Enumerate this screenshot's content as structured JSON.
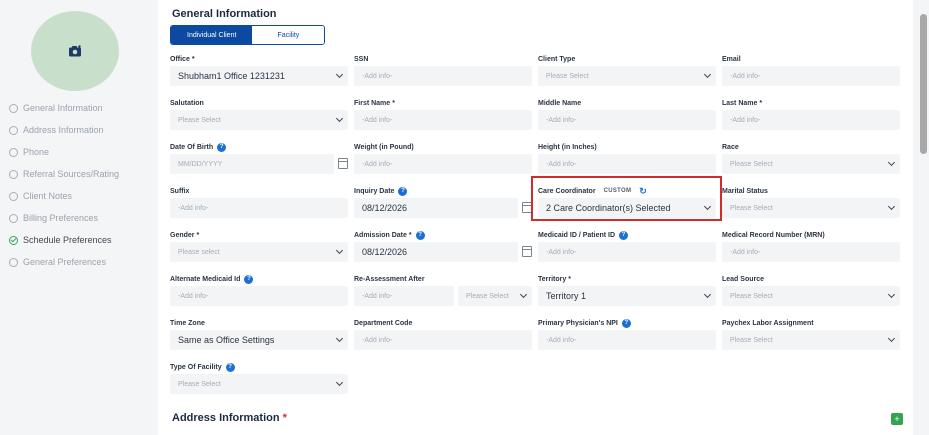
{
  "sidebar": {
    "items": [
      {
        "label": "General Information",
        "done": false
      },
      {
        "label": "Address Information",
        "done": false
      },
      {
        "label": "Phone",
        "done": false
      },
      {
        "label": "Referral Sources/Rating",
        "done": false
      },
      {
        "label": "Client Notes",
        "done": false
      },
      {
        "label": "Billing Preferences",
        "done": false
      },
      {
        "label": "Schedule Preferences",
        "done": true
      },
      {
        "label": "General Preferences",
        "done": false
      }
    ]
  },
  "general": {
    "title": "General Information",
    "toggle": {
      "individual": "Individual Client",
      "facility": "Facility"
    }
  },
  "fields": {
    "office": {
      "label": "Office",
      "req": "*",
      "value": "Shubham1 Office 1231231"
    },
    "ssn": {
      "label": "SSN",
      "placeholder": "-Add info-"
    },
    "client_type": {
      "label": "Client Type",
      "placeholder": "Please Select"
    },
    "email": {
      "label": "Email",
      "placeholder": "-Add info-"
    },
    "salutation": {
      "label": "Salutation",
      "placeholder": "Please Select"
    },
    "first_name": {
      "label": "First Name",
      "req": "*",
      "placeholder": "-Add info-"
    },
    "middle_name": {
      "label": "Middle Name",
      "placeholder": "-Add info-"
    },
    "last_name": {
      "label": "Last Name",
      "req": "*",
      "placeholder": "-Add info-"
    },
    "dob": {
      "label": "Date Of Birth",
      "placeholder": "MM/DD/YYYY"
    },
    "weight": {
      "label": "Weight (in Pound)",
      "placeholder": "-Add info-"
    },
    "height": {
      "label": "Height (in Inches)",
      "placeholder": "-Add info-"
    },
    "race": {
      "label": "Race",
      "placeholder": "Please Select"
    },
    "suffix": {
      "label": "Suffix",
      "placeholder": "-Add info-"
    },
    "inquiry_date": {
      "label": "Inquiry Date",
      "value": "08/12/2026"
    },
    "care_coordinator": {
      "label": "Care Coordinator",
      "tag": "CUSTOM",
      "value": "2 Care Coordinator(s) Selected"
    },
    "marital_status": {
      "label": "Marital Status",
      "placeholder": "Please Select"
    },
    "gender": {
      "label": "Gender",
      "req": "*",
      "placeholder": "Please select"
    },
    "admission_date": {
      "label": "Admission Date",
      "req": "*",
      "value": "08/12/2026"
    },
    "medicaid_id": {
      "label": "Medicaid ID / Patient ID",
      "placeholder": "-Add info-"
    },
    "mrn": {
      "label": "Medical Record Number (MRN)",
      "placeholder": "-Add info-"
    },
    "alt_medicaid": {
      "label": "Alternate Medicaid Id",
      "placeholder": "-Add info-"
    },
    "reassessment": {
      "label": "Re-Assessment After",
      "placeholder": "-Add info-",
      "unit_placeholder": "Please Select"
    },
    "territory": {
      "label": "Territory",
      "req": "*",
      "value": "Territory 1"
    },
    "lead_source": {
      "label": "Lead Source",
      "placeholder": "Please Select"
    },
    "time_zone": {
      "label": "Time Zone",
      "value": "Same as Office Settings"
    },
    "department_code": {
      "label": "Department Code",
      "placeholder": "-Add info-"
    },
    "primary_npi": {
      "label": "Primary Physician's NPI",
      "placeholder": "-Add info-"
    },
    "paychex": {
      "label": "Paychex Labor Assignment",
      "placeholder": "Please Select"
    },
    "facility_type": {
      "label": "Type Of Facility",
      "placeholder": "Please Select"
    }
  },
  "address": {
    "title": "Address Information",
    "req": "*",
    "add_label": "+"
  },
  "colors": {
    "accent": "#0b4aa0",
    "info": "#1c6fd6",
    "highlight": "#d12c2c",
    "success": "#35a452"
  },
  "icons": {
    "avatar": "camera-icon",
    "info": "help-circle-icon",
    "calendar": "calendar-icon",
    "refresh": "refresh-icon"
  }
}
